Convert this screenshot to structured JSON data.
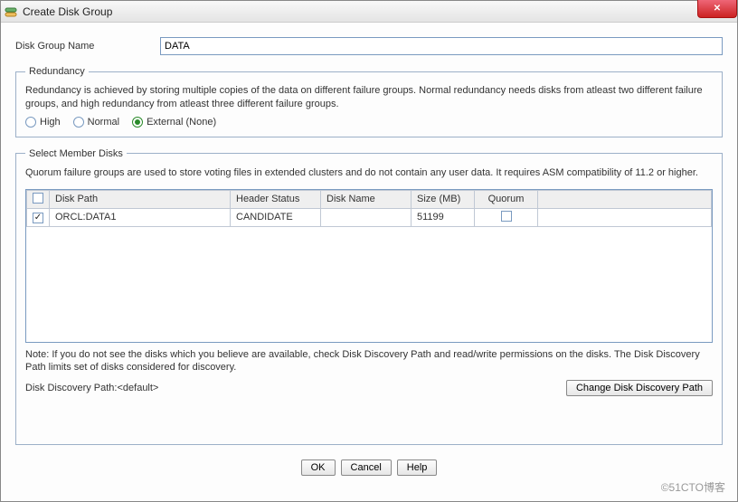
{
  "window": {
    "title": "Create Disk Group"
  },
  "form": {
    "name_label": "Disk Group Name",
    "name_value": "DATA"
  },
  "redundancy": {
    "legend": "Redundancy",
    "desc": "Redundancy is achieved by storing multiple copies of the data on different failure groups. Normal redundancy needs disks from atleast two different failure groups, and high redundancy from atleast three different failure groups.",
    "options": {
      "high": "High",
      "normal": "Normal",
      "external": "External (None)"
    },
    "selected": "external"
  },
  "disks": {
    "legend": "Select Member Disks",
    "desc": "Quorum failure groups are used to store voting files in extended clusters and do not contain any user data. It requires ASM compatibility of 11.2 or higher.",
    "headers": {
      "path": "Disk Path",
      "header_status": "Header Status",
      "name": "Disk Name",
      "size": "Size (MB)",
      "quorum": "Quorum"
    },
    "rows": [
      {
        "checked": true,
        "path": "ORCL:DATA1",
        "header_status": "CANDIDATE",
        "name": "",
        "size": "51199",
        "quorum": false
      }
    ],
    "note": "Note: If you do not see the disks which you believe are available, check Disk Discovery Path and read/write permissions on the disks. The Disk Discovery Path limits set of disks considered for discovery.",
    "discovery_label": "Disk Discovery Path:",
    "discovery_value": "<default>",
    "change_path_button": "Change Disk Discovery Path"
  },
  "buttons": {
    "ok": "OK",
    "cancel": "Cancel",
    "help": "Help"
  },
  "watermark": "©51CTO博客"
}
